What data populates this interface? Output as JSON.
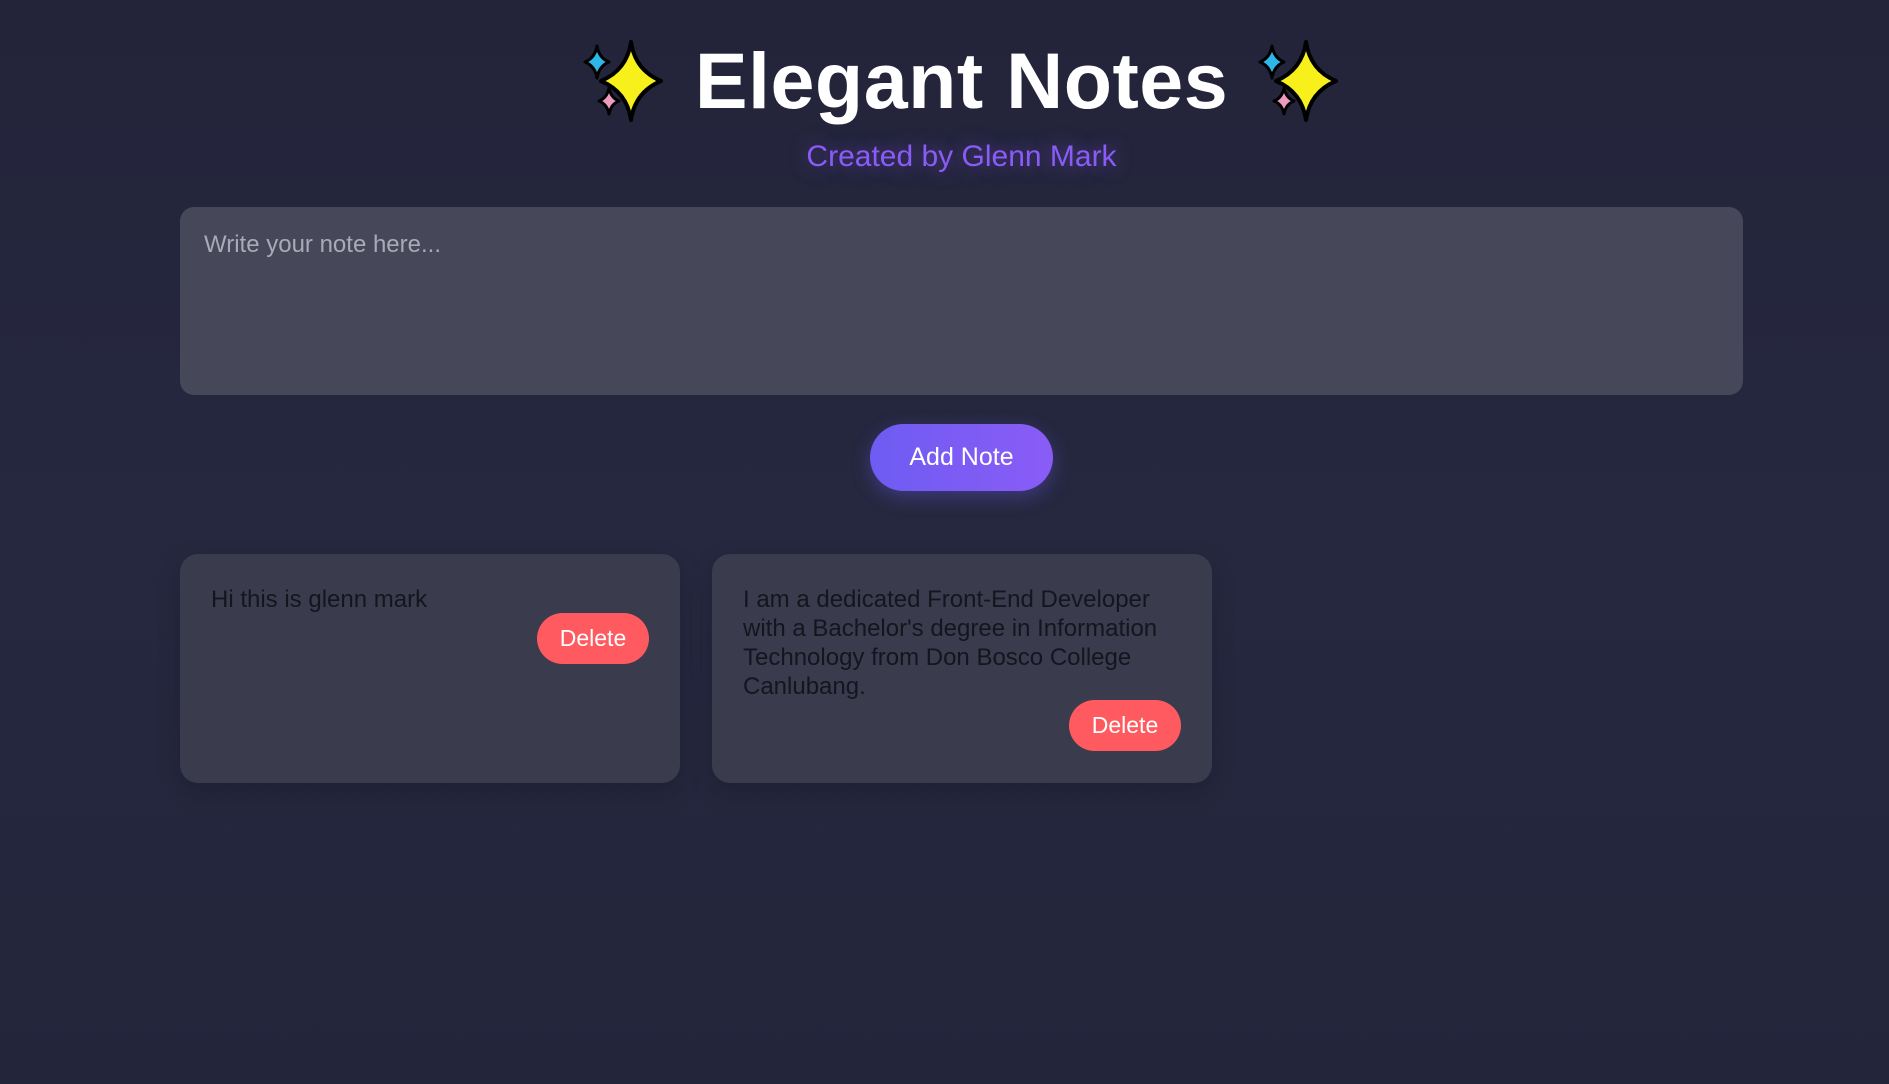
{
  "header": {
    "title": "Elegant Notes",
    "subtitle": "Created by Glenn Mark",
    "left_icon": "sparkles-icon",
    "right_icon": "sparkles-icon"
  },
  "input": {
    "placeholder": "Write your note here...",
    "value": ""
  },
  "add_button": {
    "label": "Add Note"
  },
  "notes": [
    {
      "text": "Hi this is glenn mark",
      "delete_label": "Delete"
    },
    {
      "text": "I am a dedicated Front-End Developer with a Bachelor's degree in Information Technology from Don Bosco College Canlubang.",
      "delete_label": "Delete"
    }
  ],
  "colors": {
    "background": "#24263b",
    "card": "#3a3b4c",
    "input": "#464758",
    "accent": "#8a5cf6",
    "delete": "#ff5a5f",
    "text": "#151520"
  }
}
